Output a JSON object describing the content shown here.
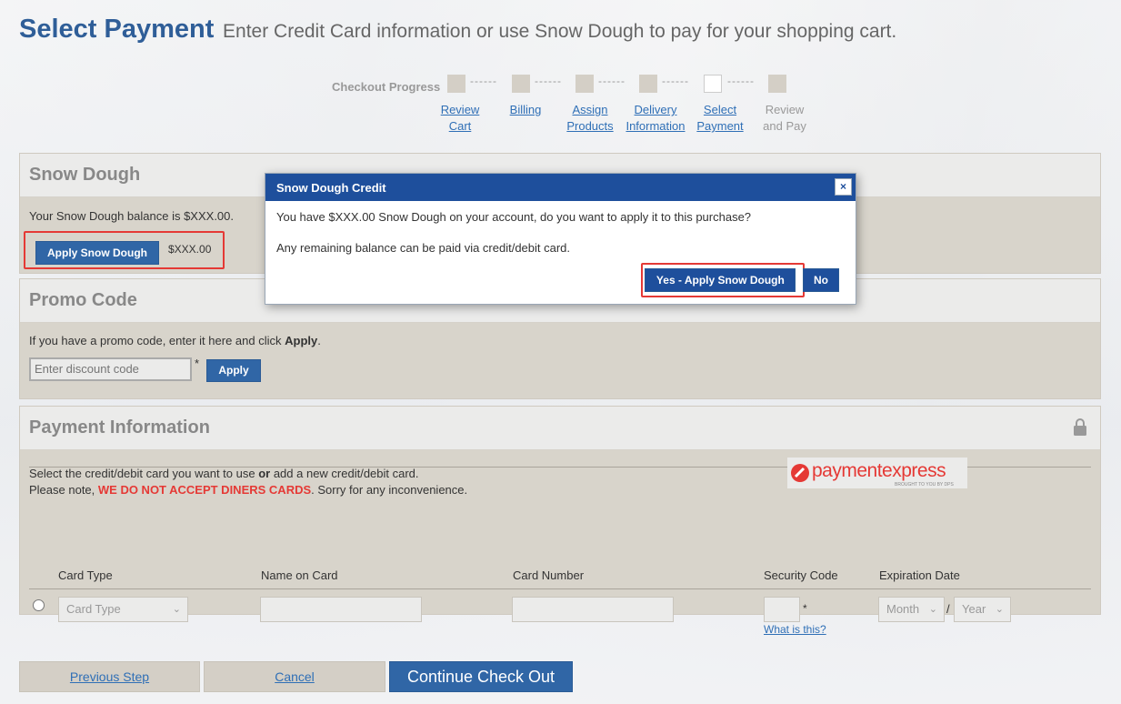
{
  "header": {
    "title": "Select Payment",
    "subtitle": "Enter Credit Card information or use Snow Dough to pay for your shopping cart."
  },
  "progress": {
    "label": "Checkout Progress",
    "dash": "------",
    "steps": [
      {
        "line1": "Review",
        "line2": "Cart"
      },
      {
        "line1": "Billing",
        "line2": ""
      },
      {
        "line1": "Assign",
        "line2": "Products"
      },
      {
        "line1": "Delivery",
        "line2": "Information"
      },
      {
        "line1": "Select",
        "line2": "Payment"
      },
      {
        "line1": "Review",
        "line2": "and Pay"
      }
    ]
  },
  "snow": {
    "title": "Snow Dough",
    "balance_text": "Your Snow Dough balance is $XXX.00.",
    "apply_label": "Apply Snow Dough",
    "amount": "$XXX.00"
  },
  "promo": {
    "title": "Promo Code",
    "instructions_pre": "If you have a promo code, enter it here and click ",
    "instructions_bold": "Apply",
    "instructions_post": ".",
    "placeholder": "Enter discount code",
    "required_mark": "*",
    "apply_label": "Apply"
  },
  "payment": {
    "title": "Payment Information",
    "line1_pre": "Select the credit/debit card you want to use ",
    "line1_bold": "or",
    "line1_post": " add a new credit/debit card.",
    "line2_pre": "Please note, ",
    "line2_red": "WE DO NOT ACCEPT DINERS CARDS",
    "line2_post": ". Sorry for any inconvenience.",
    "brand_name": "paymentexpress",
    "brand_tagline": "BROUGHT TO YOU BY DPS",
    "columns": [
      "Card Type",
      "Name on Card",
      "Card Number",
      "Security Code",
      "Expiration Date"
    ],
    "card_type_value": "Card Type",
    "required_mark": "*",
    "what_is_this": "What is this?",
    "month_value": "Month",
    "separator": "/",
    "year_value": "Year"
  },
  "modal": {
    "title": "Snow Dough Credit",
    "close": "×",
    "message1": "You have $XXX.00 Snow Dough on your account, do you want to apply it to this purchase?",
    "message2": "Any remaining balance can be paid via credit/debit card.",
    "yes_label": "Yes - Apply Snow Dough",
    "no_label": "No"
  },
  "footer": {
    "previous_label": "Previous Step",
    "cancel_label": "Cancel",
    "continue_label": "Continue Check Out"
  },
  "colors": {
    "primary": "#3066a6",
    "modal_header": "#1e4f9c",
    "highlight": "#e53935"
  }
}
